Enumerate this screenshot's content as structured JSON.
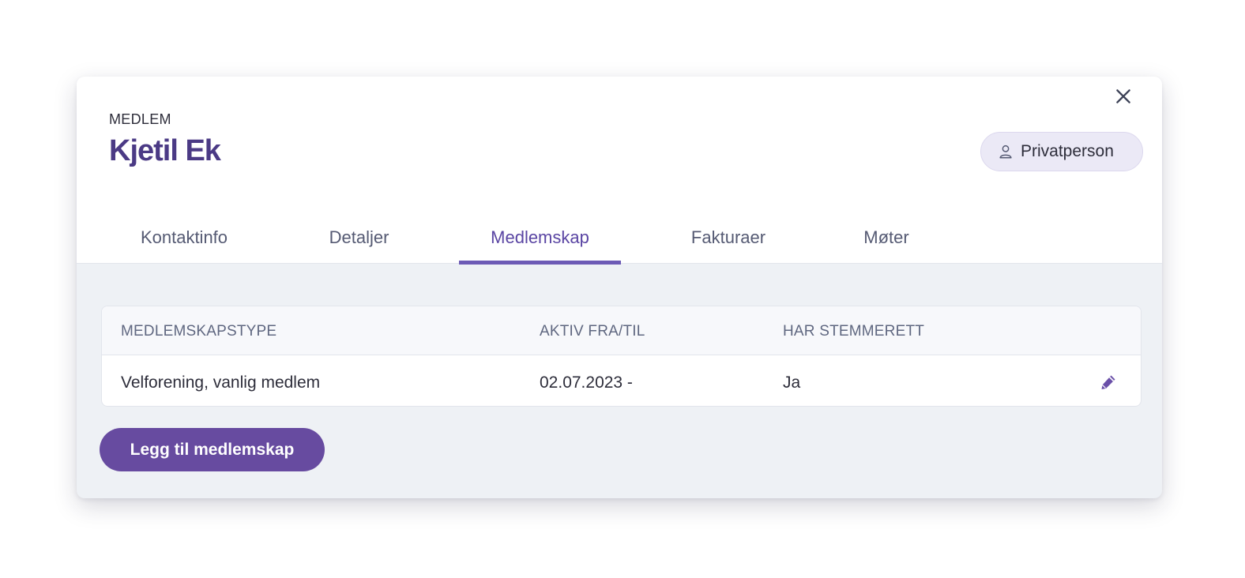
{
  "dialog": {
    "kicker": "MEDLEM",
    "name": "Kjetil Ek",
    "badge_label": "Privatperson",
    "badge_icon": "user-icon",
    "close_icon": "close-icon"
  },
  "tabs": [
    {
      "label": "Kontaktinfo",
      "active": false
    },
    {
      "label": "Detaljer",
      "active": false
    },
    {
      "label": "Medlemskap",
      "active": true
    },
    {
      "label": "Fakturaer",
      "active": false
    },
    {
      "label": "Møter",
      "active": false
    }
  ],
  "memberships": {
    "columns": [
      "MEDLEMSKAPSTYPE",
      "AKTIV FRA/TIL",
      "HAR STEMMERETT"
    ],
    "rows": [
      {
        "type": "Velforening, vanlig medlem",
        "active_period": "02.07.2023 -",
        "voting_right": "Ja",
        "action_icon": "pencil-icon"
      }
    ]
  },
  "actions": {
    "add_membership_label": "Legg til medlemskap"
  },
  "colors": {
    "accent": "#674ba0",
    "active_tab": "#6c5ab5",
    "title": "#4b3a85",
    "panel_bg": "#eef1f5"
  }
}
